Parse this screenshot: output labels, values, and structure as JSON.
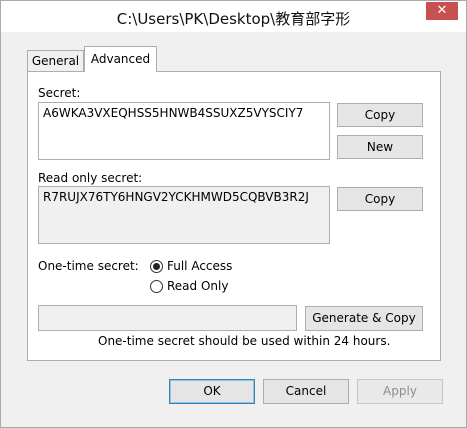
{
  "window": {
    "title": "C:\\Users\\PK\\Desktop\\教育部字形",
    "close_glyph": "✕"
  },
  "tabs": [
    {
      "label": "General",
      "active": false
    },
    {
      "label": "Advanced",
      "active": true
    }
  ],
  "secret": {
    "label": "Secret:",
    "value": "A6WKA3VXEQHSS5HNWB4SSUXZ5VYSCIY7",
    "copy_label": "Copy",
    "new_label": "New"
  },
  "read_only_secret": {
    "label": "Read only secret:",
    "value": "R7RUJX76TY6HNGV2YCKHMWD5CQBVB3R2J",
    "copy_label": "Copy"
  },
  "one_time": {
    "label": "One-time secret:",
    "options": [
      {
        "label": "Full Access",
        "checked": true
      },
      {
        "label": "Read Only",
        "checked": false
      }
    ],
    "field_value": "",
    "generate_label": "Generate & Copy",
    "note": "One-time secret should be used within 24 hours."
  },
  "footer": {
    "ok_label": "OK",
    "cancel_label": "Cancel",
    "apply_label": "Apply"
  }
}
